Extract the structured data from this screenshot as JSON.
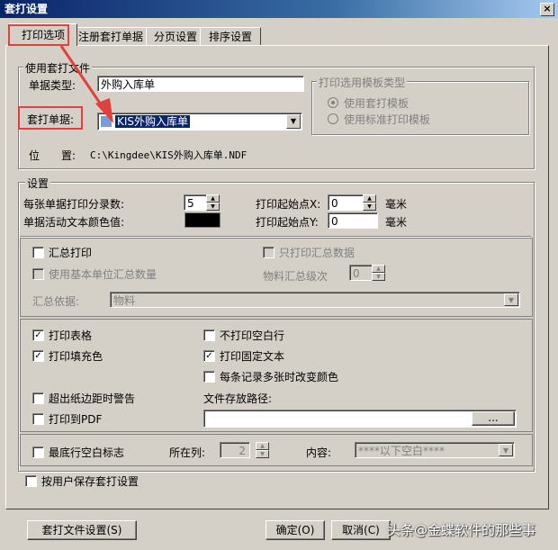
{
  "window": {
    "title": "套打设置",
    "close": "×"
  },
  "tabs": [
    "打印选项",
    "注册套打单据",
    "分页设置",
    "排序设置"
  ],
  "use_template": {
    "legend": "使用套打文件",
    "doc_type_label": "单据类型:",
    "doc_type_value": "外购入库单",
    "template_label": "套打单据:",
    "template_value": "KIS外购入库单",
    "location_label": "位　　置:",
    "location_value": "C:\\Kingdee\\KIS外购入库单.NDF",
    "print_template_type": {
      "legend": "打印选用模板类型",
      "opt_template": "使用套打模板",
      "opt_standard": "使用标准打印模板"
    }
  },
  "settings": {
    "legend": "设置",
    "entries_label": "每张单据打印分录数:",
    "entries_value": "5",
    "color_label": "单据活动文本颜色值:",
    "start_x_label": "打印起始点X:",
    "start_x_value": "0",
    "start_y_label": "打印起始点Y:",
    "start_y_value": "0",
    "unit_mm": "毫米"
  },
  "summary": {
    "sum_print": "汇总打印",
    "only_sum": "只打印汇总数据",
    "basic_unit_qty": "使用基本单位汇总数量",
    "level_label": "物料汇总级次",
    "level_value": "0",
    "basis_label": "汇总依据:",
    "basis_value": "物料"
  },
  "options": {
    "print_table": "打印表格",
    "no_blank_rows": "不打印空白行",
    "print_fill": "打印填充色",
    "print_fixed_text": "打印固定文本",
    "change_color": "每条记录多张时改变颜色",
    "overflow_warning": "超出纸边距时警告",
    "save_path_label": "文件存放路径:",
    "print_pdf": "打印到PDF",
    "browse": "..."
  },
  "bottom_row": {
    "blank_mark": "最底行空白标志",
    "col_label": "所在列:",
    "col_value": "2",
    "content_label": "内容:",
    "content_value": "****以下空白****"
  },
  "save_per_user": "按用户保存套打设置",
  "buttons": {
    "template_settings": "套打文件设置(S)",
    "ok": "确定(O)",
    "cancel": "取消(C)"
  },
  "watermark": "头条@金蝶软件的那些事",
  "colors": {
    "annotation": "#e0413a",
    "title_start": "#0a246a"
  }
}
